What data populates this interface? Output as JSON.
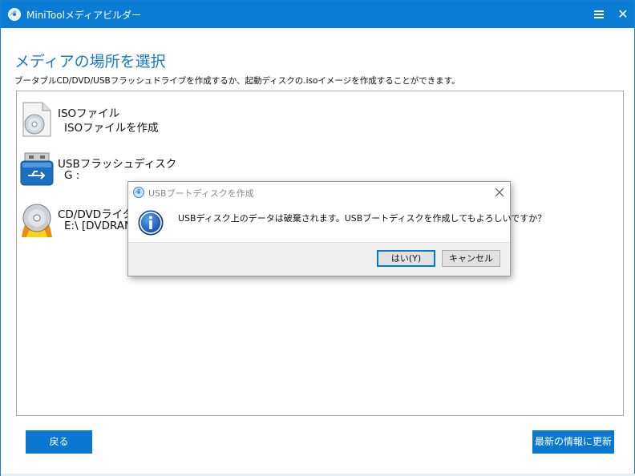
{
  "window": {
    "title": "MiniToolメディアビルダー",
    "accent_color": "#0a7cd4"
  },
  "main": {
    "heading": "メディアの場所を選択",
    "subheading": "ブータブルCD/DVD/USBフラッシュドライブを作成するか、起動ディスクの.isoイメージを作成することができます。",
    "options": [
      {
        "icon": "iso-disc-icon",
        "title": "ISOファイル",
        "subtitle": "ISOファイルを作成"
      },
      {
        "icon": "usb-drive-icon",
        "title": "USBフラッシュディスク",
        "subtitle": "G :"
      },
      {
        "icon": "dvd-burn-icon",
        "title": "CD/DVDライタ",
        "subtitle": "E:\\ [DVDRAM"
      }
    ]
  },
  "buttons": {
    "back": "戻る",
    "refresh": "最新の情報に更新"
  },
  "dialog": {
    "title": "USBブートディスクを作成",
    "message": "USBディスク上のデータは破棄されます。USBブートディスクを作成してもよろしいですか？",
    "yes": "はい(Y)",
    "cancel": "キャンセル"
  }
}
